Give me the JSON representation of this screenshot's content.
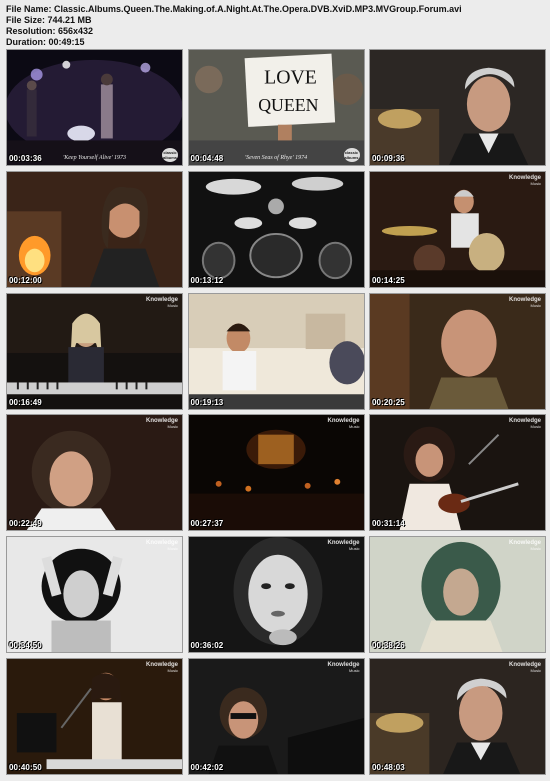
{
  "header": {
    "file_name_label": "File Name:",
    "file_name": "Classic.Albums.Queen.The.Making.of.A.Night.At.The.Opera.DVB.XviD.MP3.MVGroup.Forum.avi",
    "file_size_label": "File Size:",
    "file_size": "744.21 MB",
    "resolution_label": "Resolution:",
    "resolution": "656x432",
    "duration_label": "Duration:",
    "duration": "00:49:15"
  },
  "logos": {
    "knowledge": "Knowledge",
    "knowledge_sub": "Music",
    "classic_albums_1": "classic",
    "classic_albums_2": "albums"
  },
  "thumbnails": [
    {
      "timestamp": "00:03:36",
      "caption": "'Keep Yourself Alive' 1973",
      "scene": "concert-stage",
      "logo": "classic"
    },
    {
      "timestamp": "00:04:48",
      "caption": "'Seven Seas of Rhye' 1974",
      "scene": "love-queen-sign",
      "logo": "classic",
      "sign_line1": "LOVE",
      "sign_line2": "QUEEN"
    },
    {
      "timestamp": "00:09:36",
      "caption": "",
      "scene": "man-drums-grey",
      "logo": ""
    },
    {
      "timestamp": "00:12:00",
      "caption": "",
      "scene": "man-fireplace",
      "logo": ""
    },
    {
      "timestamp": "00:13:12",
      "caption": "",
      "scene": "drum-kit-bw",
      "logo": ""
    },
    {
      "timestamp": "00:14:25",
      "caption": "",
      "scene": "drummer-playing",
      "logo": "knowledge"
    },
    {
      "timestamp": "00:16:49",
      "caption": "",
      "scene": "man-keyboard",
      "logo": "knowledge"
    },
    {
      "timestamp": "00:19:13",
      "caption": "",
      "scene": "man-sofa",
      "logo": ""
    },
    {
      "timestamp": "00:20:25",
      "caption": "",
      "scene": "bald-man",
      "logo": "knowledge"
    },
    {
      "timestamp": "00:22:49",
      "caption": "",
      "scene": "curly-man",
      "logo": "knowledge"
    },
    {
      "timestamp": "00:27:37",
      "caption": "",
      "scene": "concert-dark",
      "logo": "knowledge"
    },
    {
      "timestamp": "00:31:14",
      "caption": "",
      "scene": "guitarist",
      "logo": "knowledge"
    },
    {
      "timestamp": "00:34:50",
      "caption": "",
      "scene": "photo-bw-hands",
      "logo": "knowledge"
    },
    {
      "timestamp": "00:36:02",
      "caption": "",
      "scene": "photo-bw-face",
      "logo": "knowledge"
    },
    {
      "timestamp": "00:38:26",
      "caption": "",
      "scene": "photo-green",
      "logo": "knowledge"
    },
    {
      "timestamp": "00:40:50",
      "caption": "",
      "scene": "keyboard-singer",
      "logo": "knowledge"
    },
    {
      "timestamp": "00:42:02",
      "caption": "",
      "scene": "man-sunglasses",
      "logo": "knowledge"
    },
    {
      "timestamp": "00:48:03",
      "caption": "",
      "scene": "man-drums-grey2",
      "logo": "knowledge"
    }
  ]
}
